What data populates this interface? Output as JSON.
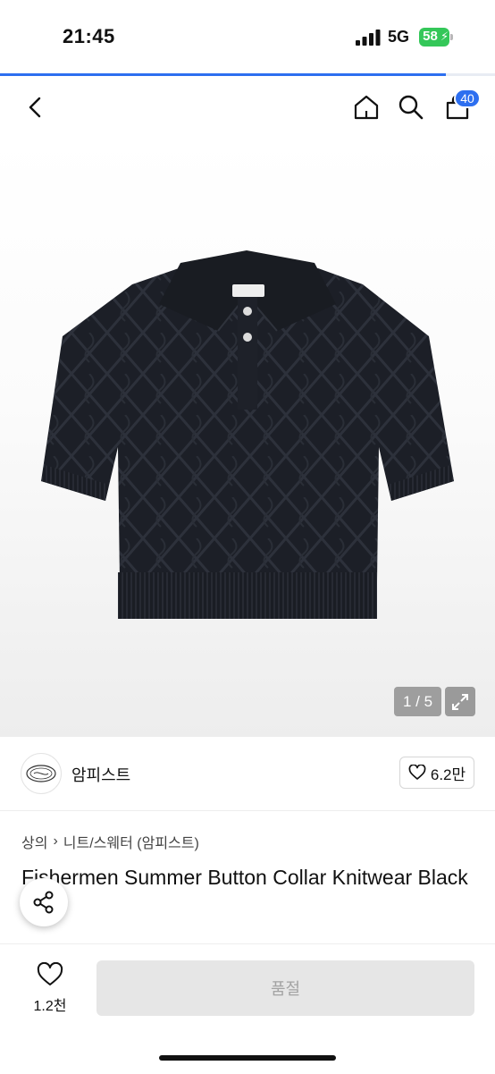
{
  "status_bar": {
    "time": "21:45",
    "network": "5G",
    "battery": "58",
    "battery_color": "#34c759"
  },
  "load_progress": 0.9,
  "nav": {
    "back_icon": "chevron-left-icon",
    "home_icon": "home-icon",
    "search_icon": "search-icon",
    "cart_icon": "shopping-bag-icon",
    "cart_count": "40",
    "accent_color": "#2d6ff0"
  },
  "gallery": {
    "counter": "1 / 5",
    "expand_icon": "expand-icon"
  },
  "brand": {
    "name": "암피스트",
    "likes": "6.2만"
  },
  "breadcrumb": {
    "level1": "상의",
    "level2": "니트/스웨터 (암피스트)"
  },
  "product": {
    "title": "Fishermen Summer Button Collar Knitwear Black"
  },
  "bottom_bar": {
    "wish_count": "1.2천",
    "action_label": "품절"
  }
}
